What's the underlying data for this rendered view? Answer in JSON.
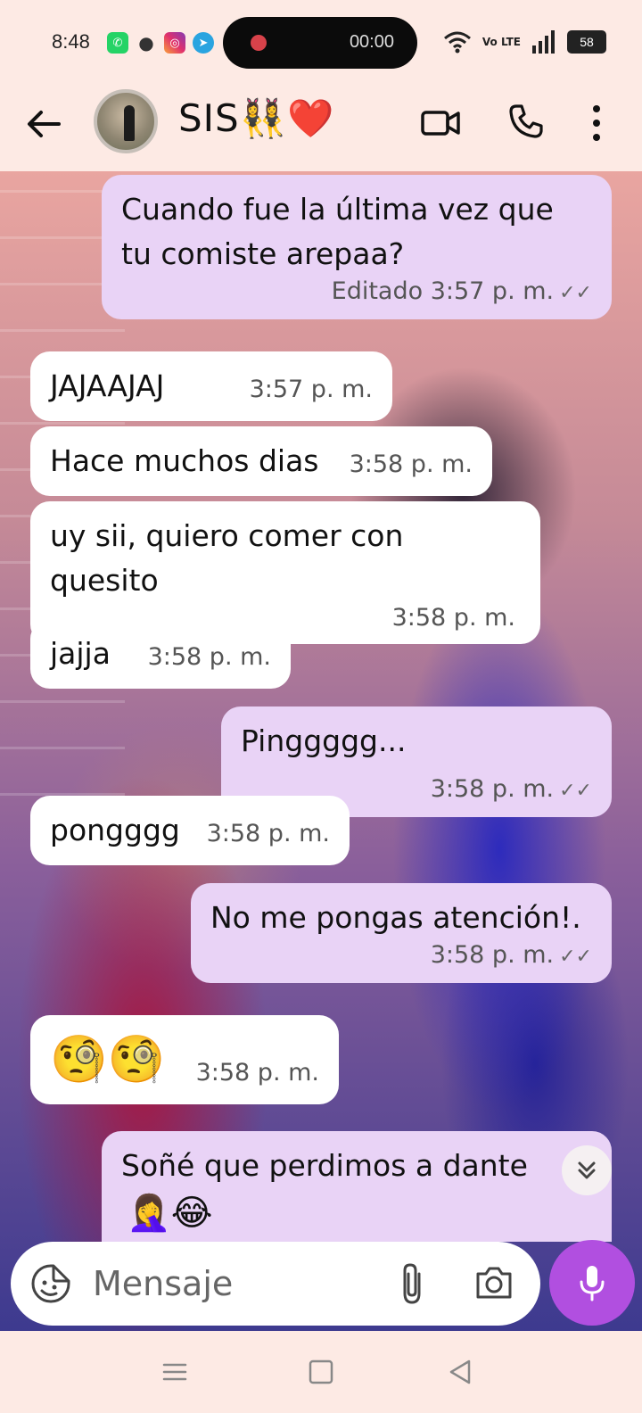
{
  "status_bar": {
    "time": "8:48",
    "recording_time": "00:00",
    "network": "Vo LTE",
    "battery": "58",
    "notification_icons": [
      "whatsapp-icon",
      "chat-bubble-icon",
      "instagram-icon",
      "telegram-icon"
    ]
  },
  "header": {
    "contact_name": "SIS👯‍♀️❤️",
    "icons": [
      "back-arrow-icon",
      "video-call-icon",
      "phone-call-icon",
      "more-options-icon"
    ]
  },
  "messages": [
    {
      "direction": "out",
      "text": "Cuando fue la última vez que tu comiste arepaa?",
      "meta": "Editado 3:57 p. m.",
      "read": true
    },
    {
      "direction": "in",
      "text": "JAJAAJAJ",
      "meta": "3:57 p. m."
    },
    {
      "direction": "in",
      "text": "Hace muchos dias",
      "meta": "3:58 p. m."
    },
    {
      "direction": "in",
      "text": "uy sii, quiero comer con quesito",
      "meta": "3:58 p. m."
    },
    {
      "direction": "in",
      "text": "jajja",
      "meta": "3:58 p. m."
    },
    {
      "direction": "out",
      "text": "Pinggggg...",
      "meta": "3:58 p. m.",
      "read": true
    },
    {
      "direction": "in",
      "text": "pongggg",
      "meta": "3:58 p. m."
    },
    {
      "direction": "out",
      "text": "No me pongas atención!.",
      "meta": "3:58 p. m.",
      "read": true
    },
    {
      "direction": "in",
      "text": "🧐🧐",
      "meta": "3:58 p. m."
    },
    {
      "direction": "out",
      "text": "Soñé que perdimos a dante",
      "meta": "",
      "partial_emoji": "🤦‍♀️😂"
    }
  ],
  "composer": {
    "placeholder": "Mensaje"
  },
  "colors": {
    "incoming_bubble": "#ffffff",
    "outgoing_bubble": "#e9d3f6",
    "accent_mic": "#b14fe0",
    "header_bg": "#fdeae4"
  }
}
